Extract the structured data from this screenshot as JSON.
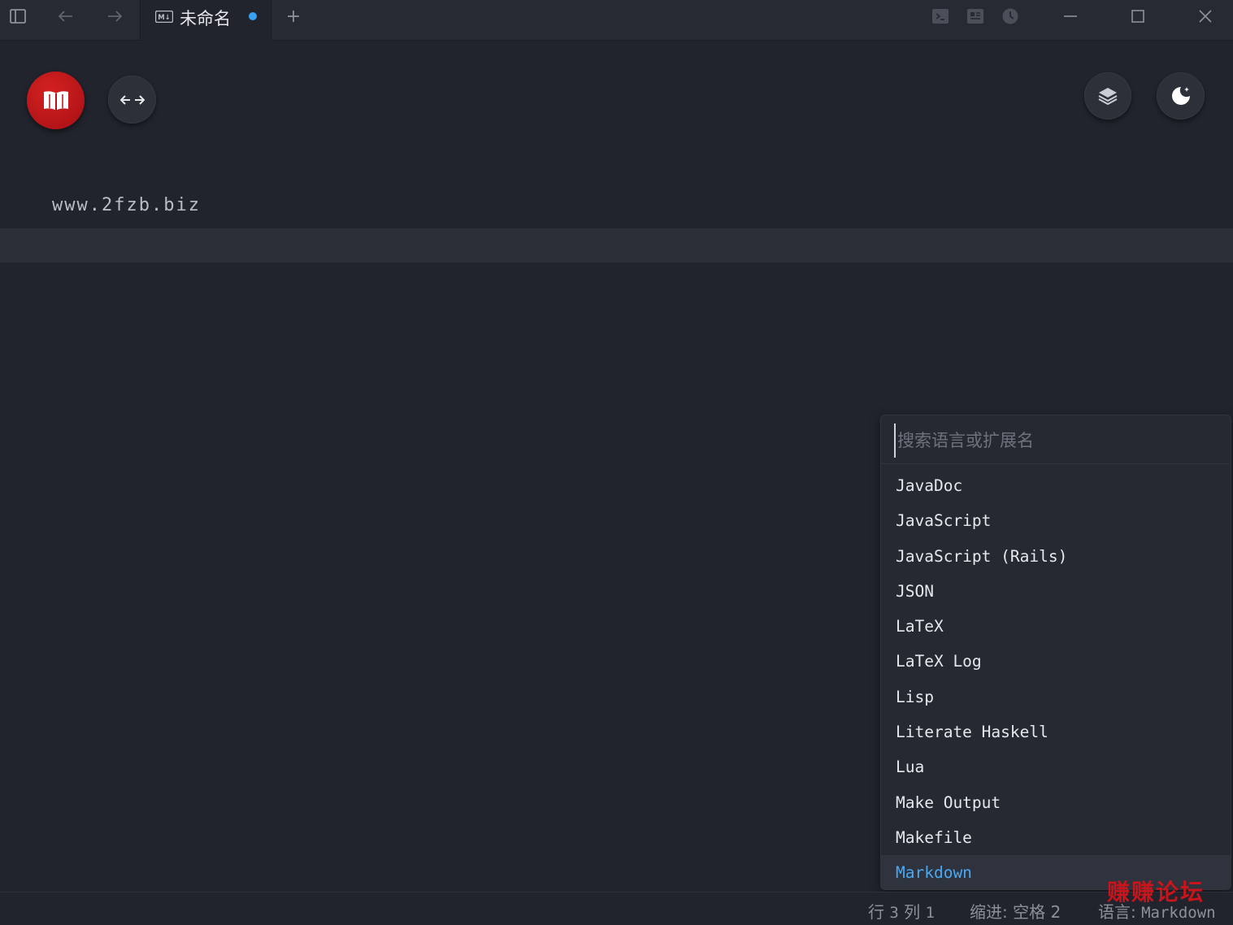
{
  "titlebar": {
    "tab_title": "未命名",
    "tab_badge": "M↓",
    "new_tab_label": "+"
  },
  "editor": {
    "line_text": "www.2fzb.biz"
  },
  "language_picker": {
    "search_placeholder": "搜索语言或扩展名",
    "items": [
      {
        "label": "JavaDoc"
      },
      {
        "label": "JavaScript"
      },
      {
        "label": "JavaScript (Rails)"
      },
      {
        "label": "JSON"
      },
      {
        "label": "LaTeX"
      },
      {
        "label": "LaTeX Log"
      },
      {
        "label": "Lisp"
      },
      {
        "label": "Literate Haskell"
      },
      {
        "label": "Lua"
      },
      {
        "label": "Make Output"
      },
      {
        "label": "Makefile"
      },
      {
        "label": "Markdown"
      }
    ],
    "selected": "Markdown"
  },
  "statusbar": {
    "row_label": "行",
    "row_value": "3",
    "col_label": "列",
    "col_value": "1",
    "indent_label": "缩进:",
    "indent_value": "空格 2",
    "lang_label": "语言:",
    "lang_value": "Markdown"
  },
  "watermark": "赚赚论坛",
  "colors": {
    "background": "#21242d",
    "accent": "#4aa8f5",
    "unsaved_dot": "#3aa0f3",
    "brand_red": "#c8141b"
  },
  "icons": [
    "sidebar-toggle-icon",
    "back-arrow-icon",
    "forward-arrow-icon",
    "markdown-file-icon",
    "terminal-icon",
    "preview-icon",
    "history-icon",
    "minimize-icon",
    "maximize-icon",
    "close-icon",
    "book-icon",
    "swap-arrows-icon",
    "layers-icon",
    "theme-moon-icon"
  ]
}
